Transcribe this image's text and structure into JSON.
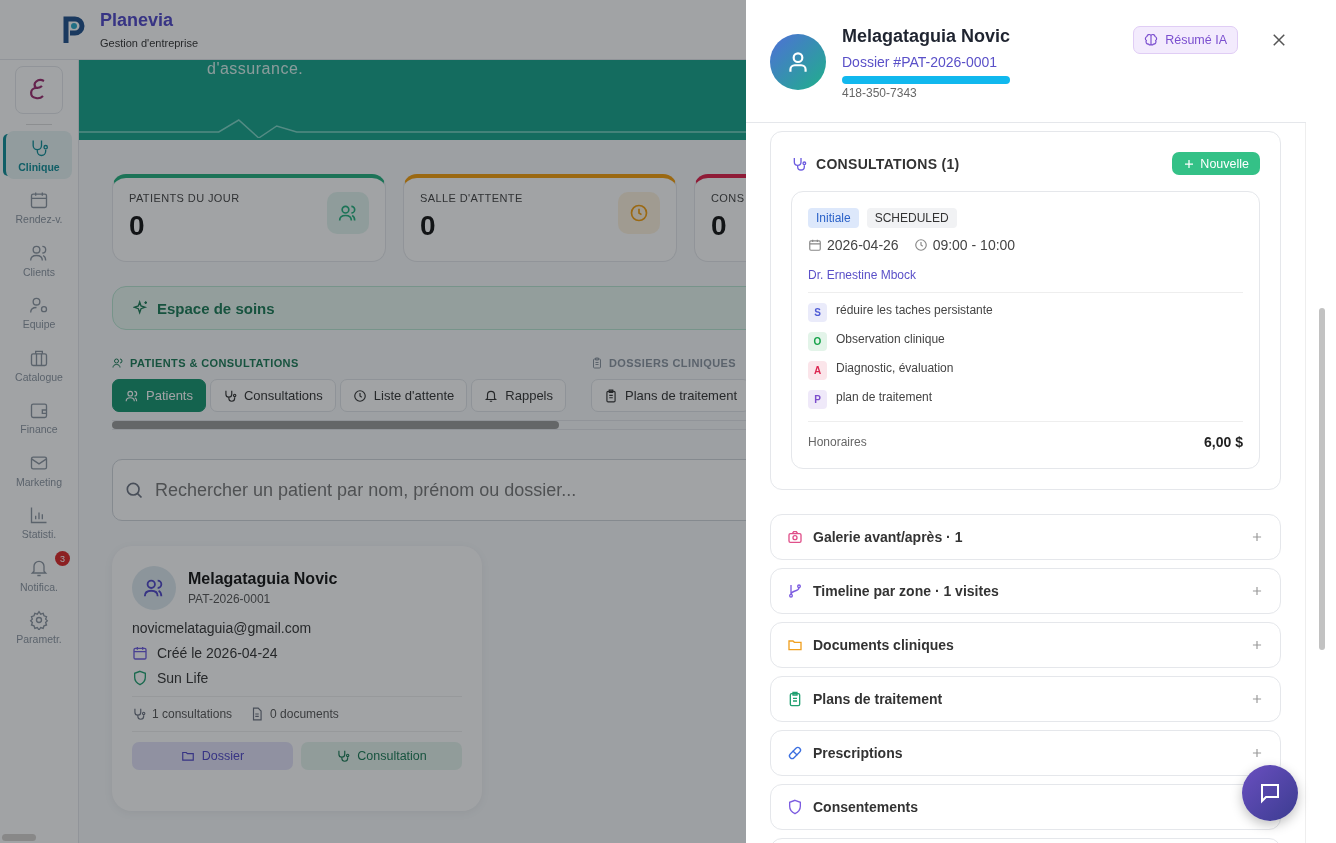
{
  "app": {
    "name": "Planevia",
    "subtitle": "Gestion d'entreprise"
  },
  "sidebar": {
    "items": [
      {
        "label": "Clinique",
        "selected": true
      },
      {
        "label": "Rendez-v.",
        "selected": false
      },
      {
        "label": "Clients",
        "selected": false
      },
      {
        "label": "Equipe",
        "selected": false
      },
      {
        "label": "Catalogue",
        "selected": false
      },
      {
        "label": "Finance",
        "selected": false
      },
      {
        "label": "Marketing",
        "selected": false
      },
      {
        "label": "Statisti.",
        "selected": false
      },
      {
        "label": "Notifica.",
        "selected": false,
        "badge": "3"
      },
      {
        "label": "Parametr.",
        "selected": false
      }
    ]
  },
  "banner": {
    "text": "d'assurance."
  },
  "stats": [
    {
      "label": "PATIENTS DU JOUR",
      "value": "0"
    },
    {
      "label": "SALLE D'ATTENTE",
      "value": "0"
    },
    {
      "label": "CONS",
      "value": "0"
    }
  ],
  "care_space": {
    "title": "Espace de soins"
  },
  "tab_groups": [
    {
      "label": "PATIENTS & CONSULTATIONS",
      "tabs": [
        {
          "label": "Patients",
          "selected": true
        },
        {
          "label": "Consultations",
          "selected": false
        },
        {
          "label": "Liste d'attente",
          "selected": false
        },
        {
          "label": "Rappels",
          "selected": false
        }
      ]
    },
    {
      "label": "DOSSIERS CLINIQUES",
      "tabs": [
        {
          "label": "Plans de traitement",
          "selected": false
        }
      ]
    }
  ],
  "search": {
    "placeholder": "Rechercher un patient par nom, prénom ou dossier..."
  },
  "patient_card": {
    "name": "Melagataguia Novic",
    "id": "PAT-2026-0001",
    "email": "novicmelataguia@gmail.com",
    "created": "Créé le 2026-04-24",
    "insurance": "Sun Life",
    "consultations": "1 consultations",
    "documents": "0 documents",
    "buttons": [
      {
        "label": "Dossier",
        "kind": "folder"
      },
      {
        "label": "Consultation",
        "kind": "stethoscope"
      }
    ]
  },
  "drawer": {
    "name": "Melagataguia Novic",
    "dossier": "Dossier #PAT-2026-0001",
    "phone": "418-350-7343",
    "ai_button": "Résumé IA",
    "consultations": {
      "title": "CONSULTATIONS (1)",
      "new_button": "Nouvelle",
      "items": [
        {
          "type": "Initiale",
          "status": "SCHEDULED",
          "date": "2026-04-26",
          "time": "09:00 - 10:00",
          "doctor": "Dr. Ernestine Mbock",
          "notes": [
            {
              "letter": "S",
              "text": "réduire les taches persistante",
              "color": "#4f5bd5"
            },
            {
              "letter": "O",
              "text": "Observation clinique",
              "color": "#16a34a"
            },
            {
              "letter": "A",
              "text": "Diagnostic, évaluation",
              "color": "#dc2650"
            },
            {
              "letter": "P",
              "text": "plan de traitement",
              "color": "#7c4dcc"
            }
          ],
          "fee_label": "Honoraires",
          "fee": "6,00 $"
        }
      ]
    },
    "sections": [
      {
        "label": "Galerie avant/après · 1",
        "kind": "camera"
      },
      {
        "label": "Timeline par zone · 1 visites",
        "kind": "branch"
      },
      {
        "label": "Documents cliniques",
        "kind": "folder"
      },
      {
        "label": "Plans de traitement",
        "kind": "clipboard"
      },
      {
        "label": "Prescriptions",
        "kind": "pill"
      },
      {
        "label": "Consentements",
        "kind": "shield"
      }
    ]
  }
}
